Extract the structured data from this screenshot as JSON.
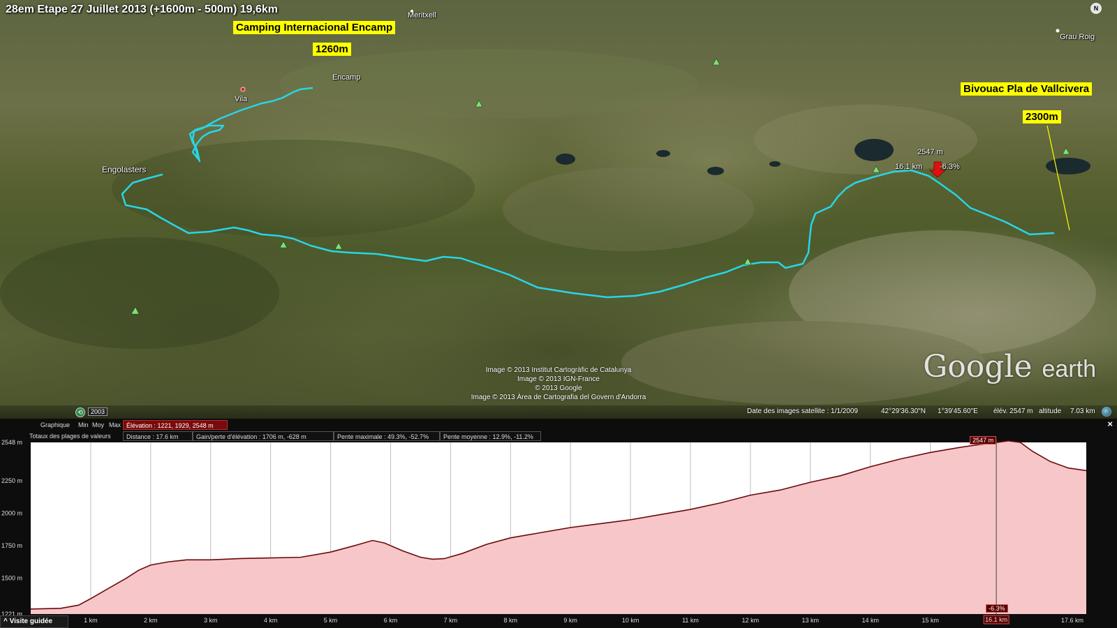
{
  "map": {
    "title": "28em Etape 27 Juillet 2013 (+1600m - 500m) 19,6km",
    "start_label": "Camping Internacional Encamp",
    "start_alt": "1260m",
    "end_label": "Bivouac Pla de Vallcivera",
    "end_alt": "2300m",
    "places": {
      "meritxell": "Meritxell",
      "encamp": "Encamp",
      "vila": "Vila",
      "engolasters": "Engolasters",
      "grau_roig": "Grau Roig"
    },
    "marker": {
      "elevation": "2547 m",
      "distance": "16.1 km",
      "slope": "-6.3%"
    },
    "credits": [
      "Image © 2013 Institut Cartogràfic de Catalunya",
      "Image © 2013 IGN-France",
      "© 2013 Google",
      "Image © 2013 Àrea de Cartografia del Govern d'Andorra"
    ],
    "logo_google": "Google",
    "logo_earth": "earth",
    "year": "2003",
    "compass": "N",
    "status": {
      "date": "Date des images satellite : 1/1/2009",
      "lat": "42°29'36.30\"N",
      "lon": "1°39'45.60\"E",
      "elev": "élév. 2547 m",
      "alt_label": "altitude",
      "alt_value": "7.03 km"
    }
  },
  "profile": {
    "row1": {
      "graph": "Graphique",
      "min": "Min",
      "avg": "Moy",
      "max": "Max",
      "elevation": "Élévation :  1221, 1929, 2548 m"
    },
    "row2": {
      "totals": "Totaux des plages de valeurs",
      "distance": "Distance :  17.6 km",
      "gain": "Gain/perte d'élévation :  1706 m, -628 m",
      "max_slope": "Pente maximale :  49.3%, -52.7%",
      "avg_slope": "Pente moyenne :  12.9%, -11.2%"
    },
    "close": "×",
    "tour_button": "^ Visite guidée",
    "cursor_elev": "2547 m",
    "cursor_slope": "-6.3%",
    "cursor_dist": "16.1 km"
  },
  "chart_data": {
    "type": "area",
    "x": [
      0,
      0.5,
      0.8,
      1.0,
      1.3,
      1.6,
      1.8,
      2.0,
      2.3,
      2.6,
      3.0,
      3.5,
      4.0,
      4.5,
      5.0,
      5.4,
      5.7,
      5.9,
      6.2,
      6.5,
      6.7,
      6.9,
      7.2,
      7.6,
      8.0,
      8.5,
      9.0,
      9.5,
      10.0,
      10.5,
      11.0,
      11.5,
      12.0,
      12.5,
      13.0,
      13.5,
      14.0,
      14.5,
      15.0,
      15.5,
      15.8,
      16.1,
      16.3,
      16.5,
      16.7,
      17.0,
      17.3,
      17.6
    ],
    "y": [
      1260,
      1265,
      1290,
      1340,
      1420,
      1500,
      1560,
      1600,
      1625,
      1640,
      1640,
      1650,
      1655,
      1660,
      1700,
      1750,
      1790,
      1770,
      1710,
      1660,
      1645,
      1650,
      1690,
      1760,
      1810,
      1850,
      1890,
      1920,
      1950,
      1990,
      2030,
      2080,
      2140,
      2180,
      2240,
      2290,
      2360,
      2420,
      2470,
      2510,
      2530,
      2547,
      2560,
      2548,
      2480,
      2400,
      2350,
      2330
    ],
    "xlabel": "",
    "ylabel": "",
    "y_ticks": [
      "1221 m",
      "1500 m",
      "1750 m",
      "2000 m",
      "2250 m",
      "2548 m"
    ],
    "y_tick_values": [
      1221,
      1500,
      1750,
      2000,
      2250,
      2548
    ],
    "x_ticks": [
      "1 km",
      "2 km",
      "3 km",
      "4 km",
      "5 km",
      "6 km",
      "7 km",
      "8 km",
      "9 km",
      "10 km",
      "11 km",
      "12 km",
      "13 km",
      "14 km",
      "15 km",
      "16.1 km",
      "17.6 km"
    ],
    "x_tick_values": [
      1,
      2,
      3,
      4,
      5,
      6,
      7,
      8,
      9,
      10,
      11,
      12,
      13,
      14,
      15,
      16.1,
      17.6
    ],
    "xlim": [
      0,
      17.6
    ],
    "ylim": [
      1221,
      2548
    ],
    "grid": true,
    "fill_color": "#f7c6c8",
    "line_color": "#6a0a0a",
    "cursor_x": 16.1
  },
  "colors": {
    "track": "#27d6e6",
    "label_bg": "#ffff00"
  }
}
